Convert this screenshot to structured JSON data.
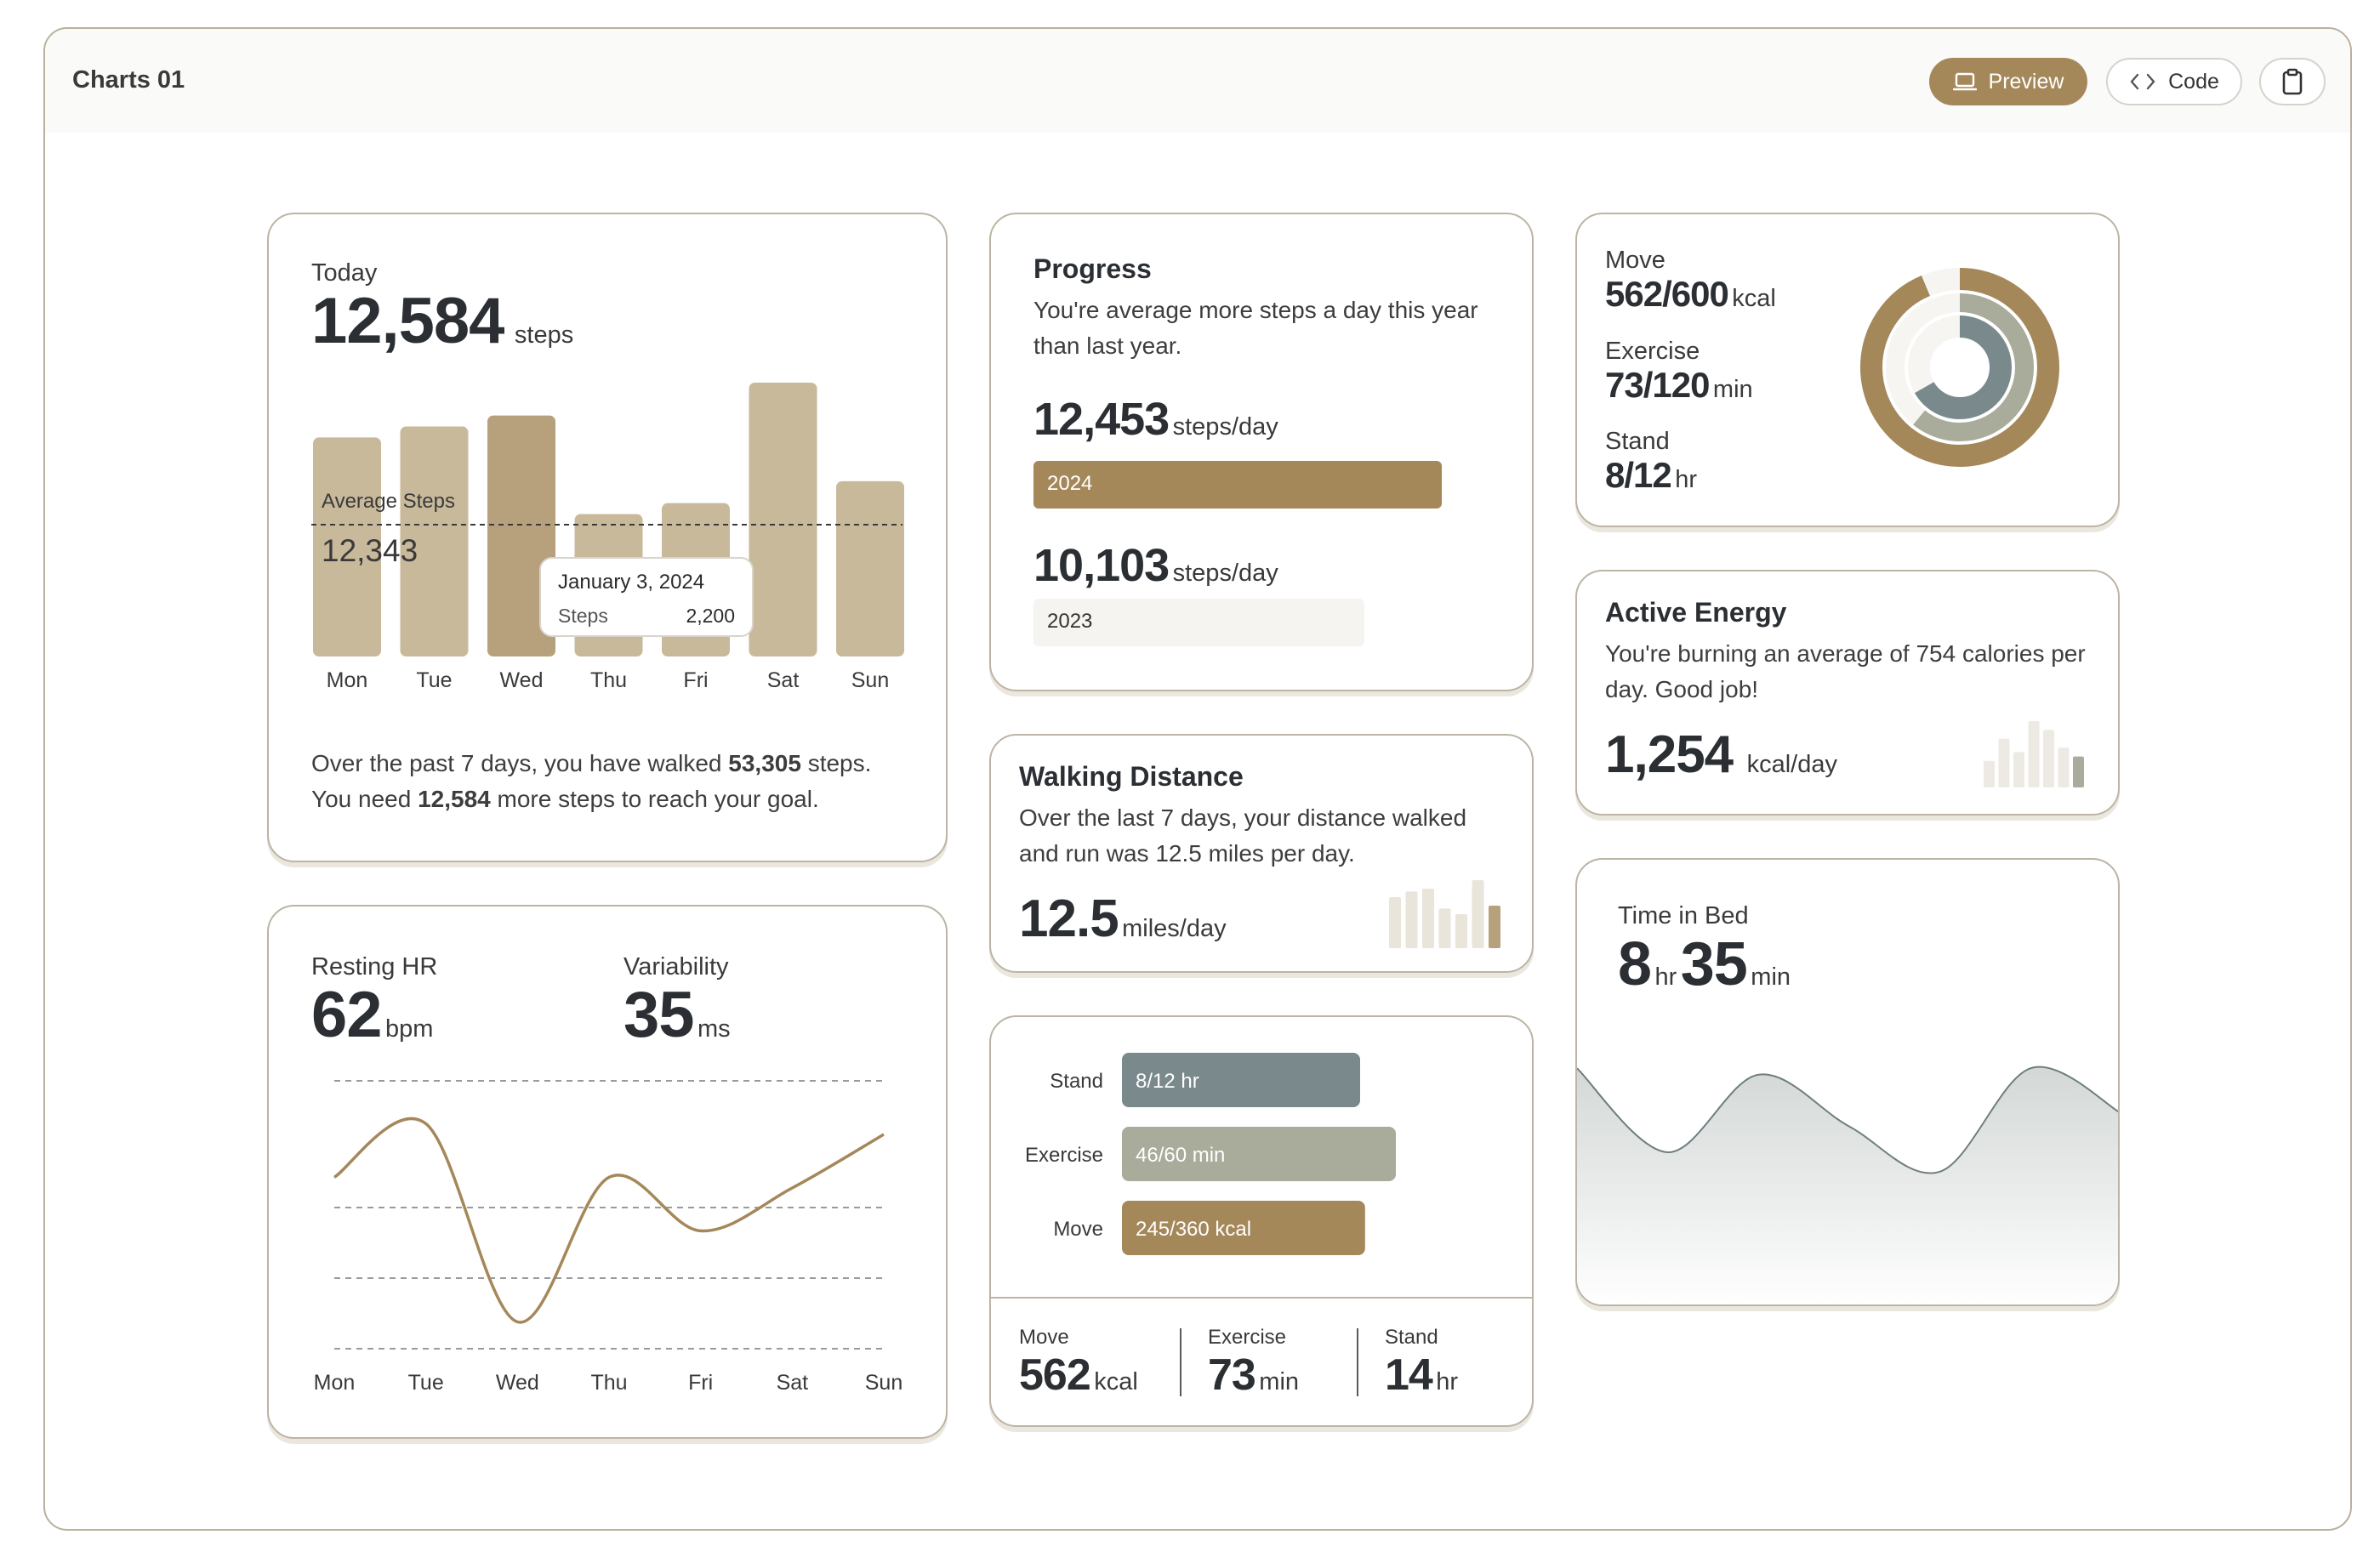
{
  "app": {
    "title": "Charts 01"
  },
  "toolbar": {
    "preview_label": "Preview",
    "code_label": "Code"
  },
  "colors": {
    "accent": "#a4885a",
    "bar": "#c9b99b",
    "bar_active": "#b7a07c",
    "slate": "#7a8a8c",
    "sage": "#a9ab9b",
    "line": "#a4885a"
  },
  "steps_card": {
    "today_label": "Today",
    "today_value": "12,584",
    "today_unit": "steps",
    "avg_label": "Average Steps",
    "avg_value": "12,343",
    "tooltip": {
      "date": "January 3, 2024",
      "label": "Steps",
      "value": "2,200"
    },
    "summary_1a": "Over the past 7 days, you have walked ",
    "summary_1b": "53,305",
    "summary_1c": " steps.",
    "summary_2a": "You need ",
    "summary_2b": "12,584",
    "summary_2c": " more steps to reach your goal."
  },
  "hr_card": {
    "resting_label": "Resting HR",
    "resting_value": "62",
    "resting_unit": "bpm",
    "var_label": "Variability",
    "var_value": "35",
    "var_unit": "ms"
  },
  "progress_card": {
    "title": "Progress",
    "desc": "You're average more steps a day this year than last year.",
    "v2024": "12,453",
    "v2024_unit": "steps/day",
    "y2024": "2024",
    "v2023": "10,103",
    "v2023_unit": "steps/day",
    "y2023": "2023"
  },
  "walking_card": {
    "title": "Walking Distance",
    "desc": "Over the last 7 days, your distance walked and run was 12.5 miles per day.",
    "value": "12.5",
    "unit": "miles/day"
  },
  "activity_card": {
    "rows": [
      {
        "label": "Stand",
        "text": "8/12 hr"
      },
      {
        "label": "Exercise",
        "text": "46/60 min"
      },
      {
        "label": "Move",
        "text": "245/360 kcal"
      }
    ],
    "footer": [
      {
        "label": "Move",
        "value": "562",
        "unit": "kcal"
      },
      {
        "label": "Exercise",
        "value": "73",
        "unit": "min"
      },
      {
        "label": "Stand",
        "value": "14",
        "unit": "hr"
      }
    ]
  },
  "rings_card": {
    "move_label": "Move",
    "move_value": "562/600",
    "move_unit": "kcal",
    "exercise_label": "Exercise",
    "exercise_value": "73/120",
    "exercise_unit": "min",
    "stand_label": "Stand",
    "stand_value": "8/12",
    "stand_unit": "hr"
  },
  "energy_card": {
    "title": "Active Energy",
    "desc": "You're burning an average of 754 calories per day. Good job!",
    "value": "1,254",
    "unit": "kcal/day"
  },
  "bed_card": {
    "label": "Time in Bed",
    "hours": "8",
    "hours_unit": "hr",
    "minutes": "35",
    "minutes_unit": "min"
  },
  "chart_data": [
    {
      "id": "steps",
      "type": "bar",
      "categories": [
        "Mon",
        "Tue",
        "Wed",
        "Thu",
        "Fri",
        "Sat",
        "Sun"
      ],
      "values": [
        2000,
        2100,
        2200,
        1300,
        1400,
        2500,
        1600
      ],
      "active_index": 2,
      "reference_line": {
        "label": "Average Steps",
        "value": 1300
      },
      "ylim": [
        0,
        2500
      ]
    },
    {
      "id": "heart_rate",
      "type": "line",
      "categories": [
        "Mon",
        "Tue",
        "Wed",
        "Thu",
        "Fri",
        "Sat",
        "Sun"
      ],
      "values": [
        62,
        72,
        35,
        62,
        52,
        60,
        70
      ],
      "ylim": [
        30,
        80
      ]
    },
    {
      "id": "steps_compare",
      "type": "bar",
      "categories": [
        "2024",
        "2023"
      ],
      "values": [
        12453,
        10103
      ]
    },
    {
      "id": "walking_mini",
      "type": "bar",
      "values": [
        18,
        20,
        21,
        14,
        12,
        24,
        15
      ]
    },
    {
      "id": "activity",
      "type": "bar",
      "categories": [
        "Stand",
        "Exercise",
        "Move"
      ],
      "values": [
        8,
        46,
        245
      ],
      "max": [
        12,
        60,
        360
      ]
    },
    {
      "id": "rings",
      "type": "pie",
      "categories": [
        "Move",
        "Exercise",
        "Stand"
      ],
      "values": [
        562,
        73,
        8
      ],
      "max": [
        600,
        120,
        12
      ]
    },
    {
      "id": "energy_mini",
      "type": "bar",
      "values": [
        12,
        22,
        16,
        30,
        26,
        18,
        14
      ]
    },
    {
      "id": "time_in_bed",
      "type": "area",
      "values": [
        8.3,
        7.0,
        8.2,
        7.4,
        6.7,
        8.3,
        7.6
      ]
    }
  ]
}
